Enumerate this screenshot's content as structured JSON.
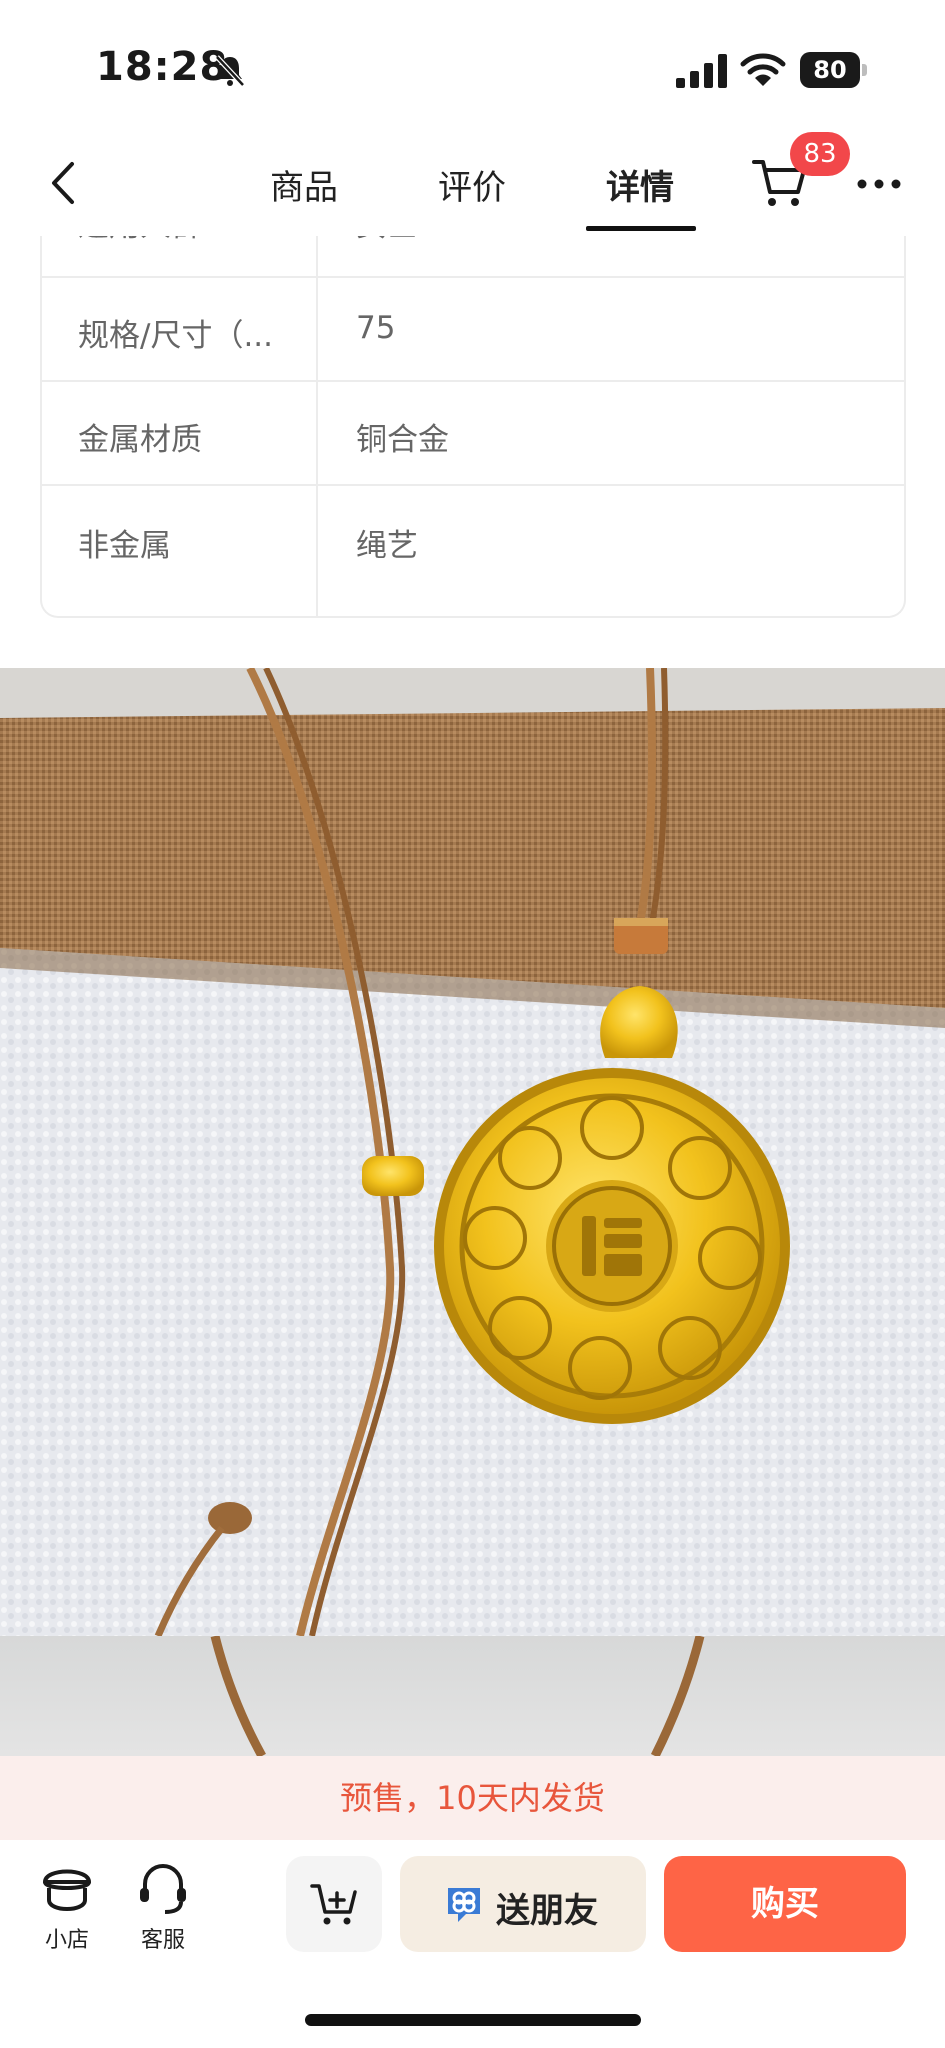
{
  "status_bar": {
    "time": "18:28",
    "battery": "80",
    "icons": [
      "bell-muted-icon",
      "cellular-signal-icon",
      "wifi-icon",
      "battery-icon"
    ]
  },
  "nav": {
    "tabs": [
      {
        "label": "商品",
        "active": false
      },
      {
        "label": "评价",
        "active": false
      },
      {
        "label": "详情",
        "active": true
      }
    ],
    "cart_badge": "83",
    "icons": [
      "back-icon",
      "cart-icon",
      "more-icon"
    ]
  },
  "spec_table": {
    "rows": [
      {
        "key": "适用人群",
        "value": "女士"
      },
      {
        "key": "规格/尺寸（...",
        "value": "75"
      },
      {
        "key": "金属材质",
        "value": "铜合金"
      },
      {
        "key": "非金属",
        "value": "绳艺"
      }
    ]
  },
  "product_image": {
    "description_icon": "gold-pendant-necklace-photo"
  },
  "presale": {
    "text": "预售，10天内发货"
  },
  "bottom_bar": {
    "shop_label": "小店",
    "service_label": "客服",
    "gift_label": "送朋友",
    "buy_label": "购买",
    "colors": {
      "buy": "#fe6446",
      "gift_bg": "#f5ede2",
      "presale_text": "#e8563c"
    }
  }
}
